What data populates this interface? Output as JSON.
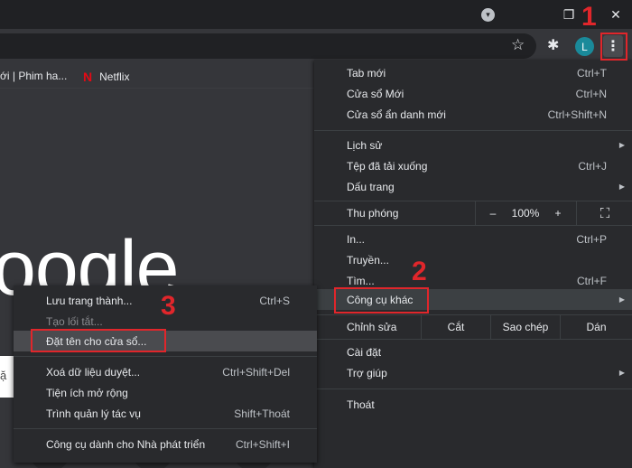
{
  "window": {
    "profile_dropdown": "▾",
    "restore": "❐",
    "close": "✕"
  },
  "toolbar": {
    "star_icon": "☆",
    "extensions_icon": "✱",
    "avatar_letter": "L",
    "menu_icon": "⋮"
  },
  "bookmarks": {
    "item1": "ới | Phim ha...",
    "item2_logo": "N",
    "item2": "Netflix"
  },
  "page": {
    "logo_text": "oogle",
    "search_partial": "ặ"
  },
  "main_menu": {
    "new_tab": {
      "label": "Tab mới",
      "shortcut": "Ctrl+T"
    },
    "new_window": {
      "label": "Cửa sổ Mới",
      "shortcut": "Ctrl+N"
    },
    "incognito": {
      "label": "Cửa sổ ẩn danh mới",
      "shortcut": "Ctrl+Shift+N"
    },
    "history": {
      "label": "Lịch sử",
      "arrow": "▶"
    },
    "downloads": {
      "label": "Tệp đã tải xuống",
      "shortcut": "Ctrl+J"
    },
    "bookmarks": {
      "label": "Dấu trang",
      "arrow": "▶"
    },
    "zoom": {
      "label": "Thu phóng",
      "minus": "–",
      "value": "100%",
      "plus": "+",
      "fullscreen": "⛶"
    },
    "print": {
      "label": "In...",
      "shortcut": "Ctrl+P"
    },
    "cast": {
      "label": "Truyền..."
    },
    "find": {
      "label": "Tìm...",
      "shortcut": "Ctrl+F"
    },
    "more_tools": {
      "label": "Công cụ khác",
      "arrow": "▶"
    },
    "edit": {
      "label": "Chỉnh sửa",
      "cut": "Cắt",
      "copy": "Sao chép",
      "paste": "Dán"
    },
    "settings": {
      "label": "Cài đặt"
    },
    "help": {
      "label": "Trợ giúp",
      "arrow": "▶"
    },
    "exit": {
      "label": "Thoát"
    }
  },
  "sub_menu": {
    "save_page": {
      "label": "Lưu trang thành...",
      "shortcut": "Ctrl+S"
    },
    "create_shortcut": {
      "label": "Tạo lối tắt..."
    },
    "name_window": {
      "label": "Đặt tên cho cửa sổ..."
    },
    "clear_data": {
      "label": "Xoá dữ liệu duyệt...",
      "shortcut": "Ctrl+Shift+Del"
    },
    "extensions": {
      "label": "Tiện ích mở rộng"
    },
    "task_manager": {
      "label": "Trình quản lý tác vụ",
      "shortcut": "Shift+Thoát"
    },
    "dev_tools": {
      "label": "Công cụ dành cho Nhà phát triển",
      "shortcut": "Ctrl+Shift+I"
    }
  },
  "annotations": {
    "step1": "1",
    "step2": "2",
    "step3": "3",
    "color": "#e0262b"
  }
}
